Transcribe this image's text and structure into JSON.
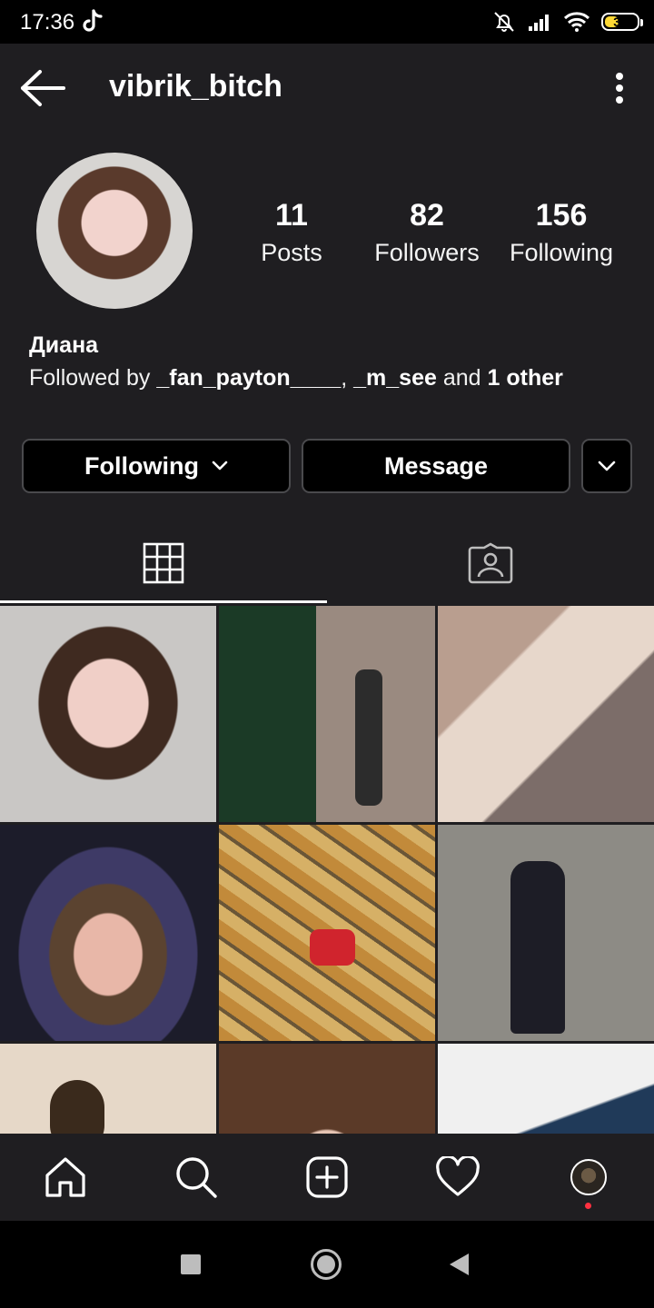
{
  "status_bar": {
    "time": "17:36",
    "battery": "35"
  },
  "header": {
    "username": "vibrik_bitch"
  },
  "profile": {
    "name": "Диана",
    "followed_by_prefix": "Followed by ",
    "follower_1": "_fan_payton____",
    "separator": ", ",
    "follower_2": "_m_see",
    "and_text": " and ",
    "others": "1 other"
  },
  "stats": {
    "posts": {
      "value": "11",
      "label": "Posts"
    },
    "followers": {
      "value": "82",
      "label": "Followers"
    },
    "following": {
      "value": "156",
      "label": "Following"
    }
  },
  "buttons": {
    "following": "Following",
    "message": "Message"
  },
  "tabs": [
    {
      "icon": "grid-icon",
      "active": true
    },
    {
      "icon": "tagged-icon",
      "active": false
    }
  ],
  "nav": [
    "home-icon",
    "search-icon",
    "add-post-icon",
    "activity-heart-icon",
    "profile-avatar"
  ],
  "colors": {
    "background": "#1f1e21",
    "button_border": "#4a4a4d",
    "notification_dot": "#ff3040"
  }
}
